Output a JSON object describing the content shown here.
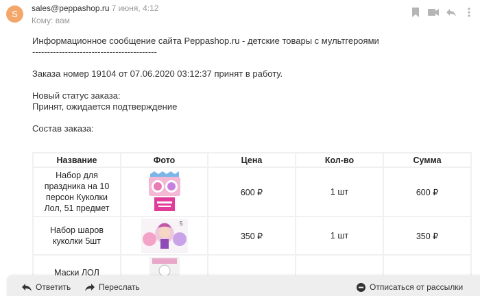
{
  "header": {
    "avatar_letter": "S",
    "from": "sales@peppashop.ru",
    "date": "7 июня, 4:12",
    "to": "Кому: вам"
  },
  "body": {
    "line1": "Информационное сообщение сайта Peppashop.ru - детские товары с мультгероями",
    "divider": "------------------------------------------",
    "order_line": "Заказа номер 19104 от 07.06.2020 03:12:37 принят в работу.",
    "status_label": "Новый статус заказа:",
    "status_value": "Принят, ожидается подтверждение",
    "composition_label": "Состав заказа:"
  },
  "table": {
    "headers": [
      "Название",
      "Фото",
      "Цена",
      "Кол-во",
      "Сумма"
    ],
    "rows": [
      {
        "name": "Набор для праздника на 10 персон Куколки Лол, 51 предмет",
        "price": "600 ₽",
        "qty": "1 шт",
        "sum": "600 ₽"
      },
      {
        "name": "Набор шаров куколки 5шт",
        "price": "350 ₽",
        "qty": "1 шт",
        "sum": "350 ₽"
      },
      {
        "name": "Маски ЛОЛ",
        "price": "",
        "qty": "",
        "sum": ""
      }
    ]
  },
  "actions": {
    "reply": "Ответить",
    "forward": "Переслать",
    "unsubscribe": "Отписаться от рассылки"
  },
  "icons": [
    "bookmark-icon",
    "video-icon",
    "reply-all-icon",
    "more-icon",
    "reply-icon",
    "forward-icon",
    "unsubscribe-icon"
  ],
  "colors": {
    "avatar": "#f3a76a",
    "bar": "#eeeeee"
  }
}
